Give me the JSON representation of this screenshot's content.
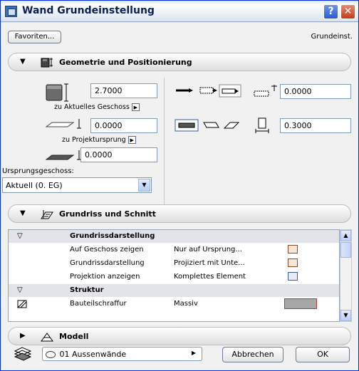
{
  "window": {
    "title": "Wand Grundeinstellung",
    "help_label": "?",
    "close_label": "✕"
  },
  "favorites_label": "Favoriten...",
  "right_label": "Grundeinst.",
  "sections": {
    "geometry": {
      "title": "Geometrie und Positionierung",
      "arrow": "▼"
    },
    "floorplan": {
      "title": "Grundriss und Schnitt",
      "arrow": "▼"
    },
    "model": {
      "title": "Modell",
      "arrow": "▶"
    }
  },
  "geometry": {
    "height_value": "2.7000",
    "to_story_label": "zu Aktuelles Geschoss",
    "base_value": "0.0000",
    "to_project_label": "zu Projektursprung",
    "offset_value": "0.0000",
    "origin_story_label": "Ursprungsgeschoss:",
    "origin_story_value": "Aktuell (0. EG)",
    "slant_value": "0.0000",
    "thickness_value": "0.3000"
  },
  "table": {
    "rows": [
      {
        "type": "group",
        "expand": "▽",
        "label": "Grundrissdarstellung",
        "value": ""
      },
      {
        "type": "item",
        "label": "Auf Geschoss zeigen",
        "value": "Nur auf Ursprung..."
      },
      {
        "type": "item",
        "label": "Grundrissdarstellung",
        "value": "Projiziert mit Unte..."
      },
      {
        "type": "item",
        "label": "Projektion anzeigen",
        "value": "Komplettes Element"
      },
      {
        "type": "group",
        "expand": "▽",
        "label": "Struktur",
        "value": ""
      },
      {
        "type": "item",
        "label": "Bauteilschraffur",
        "value": "Massiv"
      }
    ]
  },
  "footer": {
    "layer_label": "01 Aussenwände",
    "cancel_label": "Abbrechen",
    "ok_label": "OK"
  },
  "icons": {
    "up": "▲",
    "down": "▼",
    "ref": "▶",
    "menu_arrow": "▶"
  }
}
